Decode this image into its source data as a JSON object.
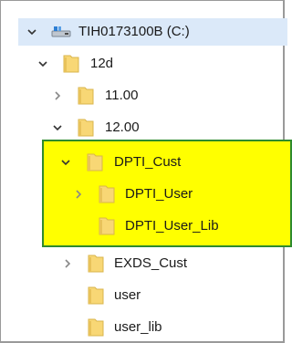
{
  "tree": {
    "drive": {
      "label": "TIH0173100B (C:)",
      "icon": "drive-icon",
      "expanded": true
    },
    "nodes": [
      {
        "label": "12d",
        "expanded": true
      },
      {
        "label": "11.00",
        "expanded": false
      },
      {
        "label": "12.00",
        "expanded": true
      },
      {
        "label": "DPTI_Cust",
        "expanded": true
      },
      {
        "label": "DPTI_User",
        "expanded": false
      },
      {
        "label": "DPTI_User_Lib"
      },
      {
        "label": "EXDS_Cust",
        "expanded": false
      },
      {
        "label": "user"
      },
      {
        "label": "user_lib"
      }
    ]
  },
  "colors": {
    "highlight_fill": "#ffff00",
    "highlight_border": "#2e8b2e",
    "selected_row": "#dbe9f9",
    "folder_fill": "#f8d775"
  }
}
